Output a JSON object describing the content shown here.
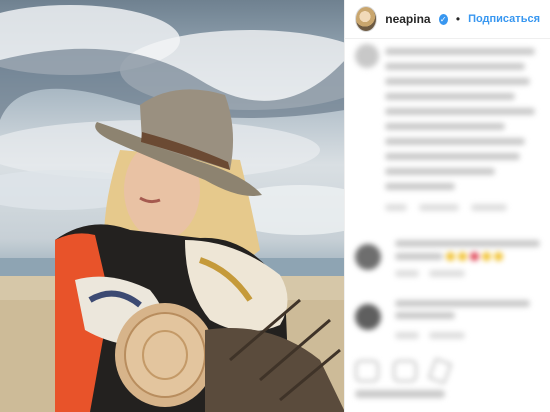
{
  "header": {
    "username": "neapina",
    "follow_label": "Подписаться",
    "separator": "•",
    "verified_glyph": "✓"
  },
  "icons": [
    "avatar",
    "verified-icon",
    "heart-icon",
    "comment-icon",
    "share-icon"
  ],
  "colors": {
    "accent": "#3897f0",
    "text": "#262626",
    "muted": "#8e8e8e",
    "border": "#efefef"
  }
}
